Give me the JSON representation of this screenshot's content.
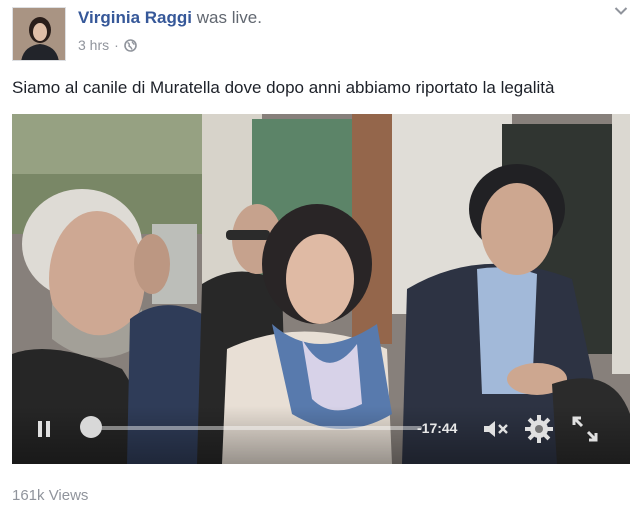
{
  "post": {
    "author": "Virginia Raggi",
    "status": "was live.",
    "time": "3 hrs",
    "separator": "·",
    "caption": "Siamo al canile di Muratella dove dopo anni abbiamo riportato la legalità"
  },
  "video": {
    "remaining_time": "-17:44",
    "progress": 0.0
  },
  "stats": {
    "views": "161k Views"
  },
  "icons": {
    "privacy": "globe-icon",
    "menu": "chevron-down-icon",
    "pause": "pause-icon",
    "volume": "mute-icon",
    "settings": "gear-icon",
    "fullscreen": "fullscreen-icon"
  }
}
